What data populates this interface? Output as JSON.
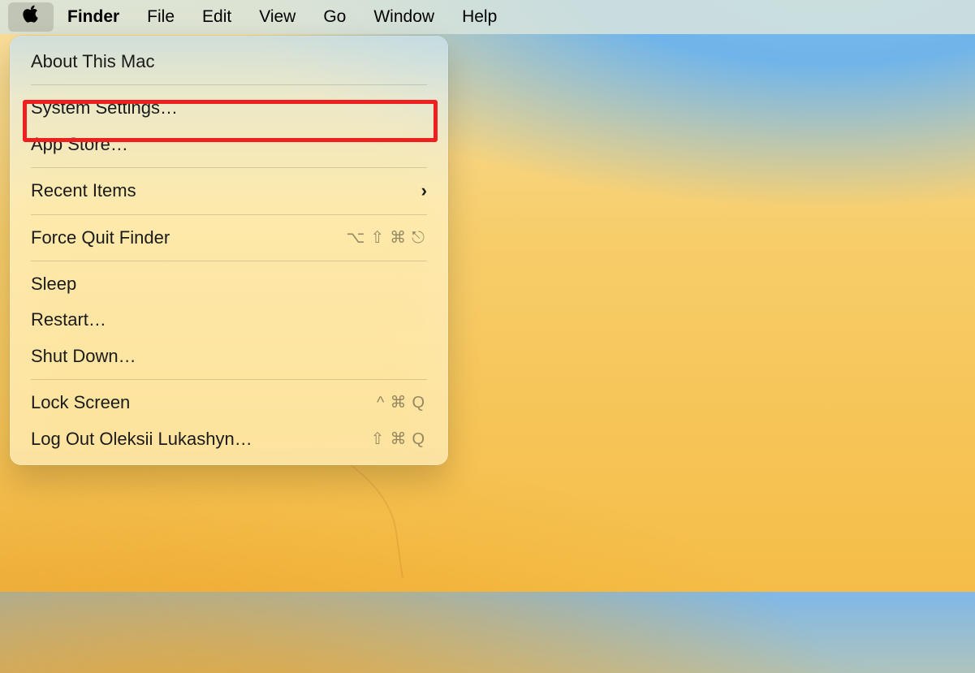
{
  "menubar": {
    "app": "Finder",
    "items": [
      "File",
      "Edit",
      "View",
      "Go",
      "Window",
      "Help"
    ]
  },
  "apple_menu": {
    "about": "About This Mac",
    "system_settings": "System Settings…",
    "app_store": "App Store…",
    "recent_items": "Recent Items",
    "force_quit": "Force Quit Finder",
    "force_quit_shortcut": "⌥⇧⌘⎋",
    "sleep": "Sleep",
    "restart": "Restart…",
    "shut_down": "Shut Down…",
    "lock_screen": "Lock Screen",
    "lock_screen_shortcut": "^⌘Q",
    "log_out": "Log Out Oleksii Lukashyn…",
    "log_out_shortcut": "⇧⌘Q"
  },
  "annotation": {
    "highlighted_item": "system_settings"
  }
}
